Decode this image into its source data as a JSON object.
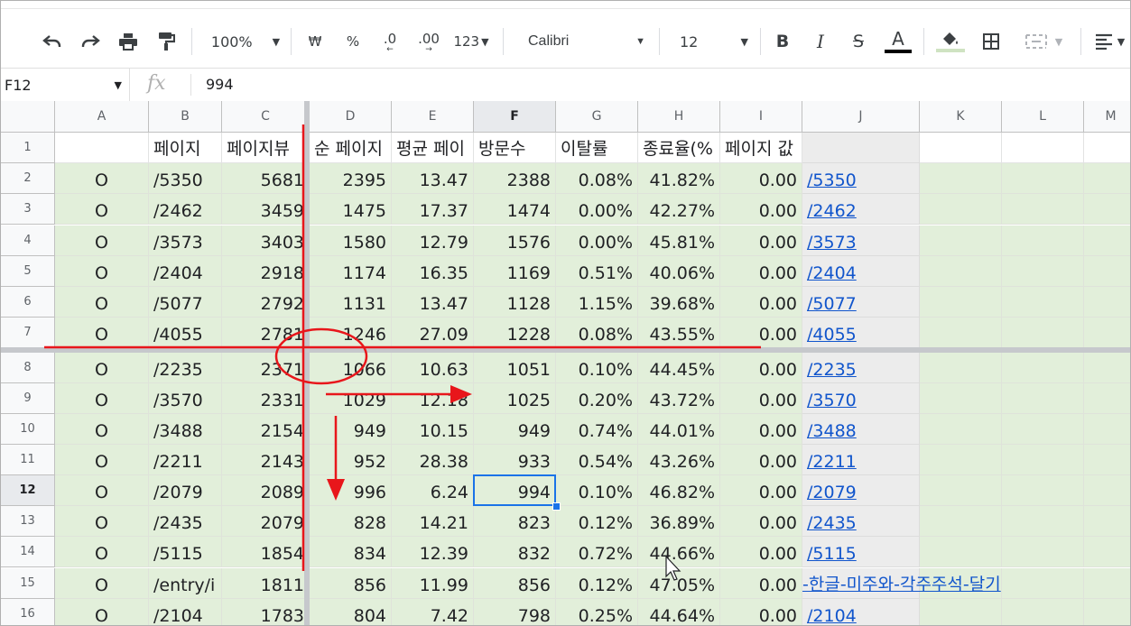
{
  "toolbar": {
    "zoom": "100%",
    "currency": "₩",
    "percent": "%",
    "dec_decrease": ".0",
    "dec_increase": ".00",
    "more_formats": "123",
    "font": "Calibri",
    "font_size": "12",
    "bold": "B",
    "italic": "I",
    "strike": "S",
    "text_color": "A",
    "text_color_value": "#000000",
    "fill_color_value": "#e2efda"
  },
  "formula_bar": {
    "name_box": "F12",
    "fx": "fx",
    "value": "994"
  },
  "columns": [
    "A",
    "B",
    "C",
    "D",
    "E",
    "F",
    "G",
    "H",
    "I",
    "J",
    "K",
    "L",
    "M"
  ],
  "selected_column": "F",
  "selected_row": "12",
  "header_row": [
    "",
    "페이지",
    "페이지뷰",
    "순 페이지",
    "평균 페이",
    "방문수",
    "이탈률",
    "종료율(%",
    "페이지 값",
    ""
  ],
  "rows": [
    {
      "n": "2",
      "a": "O",
      "b": "/5350",
      "c": "5681",
      "d": "2395",
      "e": "13.47",
      "f": "2388",
      "g": "0.08%",
      "h": "41.82%",
      "i": "0.00",
      "j": "/5350"
    },
    {
      "n": "3",
      "a": "O",
      "b": "/2462",
      "c": "3459",
      "d": "1475",
      "e": "17.37",
      "f": "1474",
      "g": "0.00%",
      "h": "42.27%",
      "i": "0.00",
      "j": "/2462"
    },
    {
      "n": "4",
      "a": "O",
      "b": "/3573",
      "c": "3403",
      "d": "1580",
      "e": "12.79",
      "f": "1576",
      "g": "0.00%",
      "h": "45.81%",
      "i": "0.00",
      "j": "/3573"
    },
    {
      "n": "5",
      "a": "O",
      "b": "/2404",
      "c": "2918",
      "d": "1174",
      "e": "16.35",
      "f": "1169",
      "g": "0.51%",
      "h": "40.06%",
      "i": "0.00",
      "j": "/2404"
    },
    {
      "n": "6",
      "a": "O",
      "b": "/5077",
      "c": "2792",
      "d": "1131",
      "e": "13.47",
      "f": "1128",
      "g": "1.15%",
      "h": "39.68%",
      "i": "0.00",
      "j": "/5077"
    },
    {
      "n": "7",
      "a": "O",
      "b": "/4055",
      "c": "2781",
      "d": "1246",
      "e": "27.09",
      "f": "1228",
      "g": "0.08%",
      "h": "43.55%",
      "i": "0.00",
      "j": "/4055"
    },
    {
      "n": "8",
      "a": "O",
      "b": "/2235",
      "c": "2371",
      "d": "1066",
      "e": "10.63",
      "f": "1051",
      "g": "0.10%",
      "h": "44.45%",
      "i": "0.00",
      "j": "/2235"
    },
    {
      "n": "9",
      "a": "O",
      "b": "/3570",
      "c": "2331",
      "d": "1029",
      "e": "12.18",
      "f": "1025",
      "g": "0.20%",
      "h": "43.72%",
      "i": "0.00",
      "j": "/3570"
    },
    {
      "n": "10",
      "a": "O",
      "b": "/3488",
      "c": "2154",
      "d": "949",
      "e": "10.15",
      "f": "949",
      "g": "0.74%",
      "h": "44.01%",
      "i": "0.00",
      "j": "/3488"
    },
    {
      "n": "11",
      "a": "O",
      "b": "/2211",
      "c": "2143",
      "d": "952",
      "e": "28.38",
      "f": "933",
      "g": "0.54%",
      "h": "43.26%",
      "i": "0.00",
      "j": "/2211"
    },
    {
      "n": "12",
      "a": "O",
      "b": "/2079",
      "c": "2089",
      "d": "996",
      "e": "6.24",
      "f": "994",
      "g": "0.10%",
      "h": "46.82%",
      "i": "0.00",
      "j": "/2079"
    },
    {
      "n": "13",
      "a": "O",
      "b": "/2435",
      "c": "2079",
      "d": "828",
      "e": "14.21",
      "f": "823",
      "g": "0.12%",
      "h": "36.89%",
      "i": "0.00",
      "j": "/2435"
    },
    {
      "n": "14",
      "a": "O",
      "b": "/5115",
      "c": "1854",
      "d": "834",
      "e": "12.39",
      "f": "832",
      "g": "0.72%",
      "h": "44.66%",
      "i": "0.00",
      "j": "/5115"
    },
    {
      "n": "15",
      "a": "O",
      "b": "/entry/i",
      "c": "1811",
      "d": "856",
      "e": "11.99",
      "f": "856",
      "g": "0.12%",
      "h": "47.05%",
      "i": "0.00",
      "j": "-한글-미주와-각주주석-달기"
    },
    {
      "n": "16",
      "a": "O",
      "b": "/2104",
      "c": "1783",
      "d": "804",
      "e": "7.42",
      "f": "798",
      "g": "0.25%",
      "h": "44.64%",
      "i": "0.00",
      "j": "/2104"
    }
  ],
  "colors": {
    "data_fill": "#e2efda",
    "link": "#1155cc",
    "selection": "#1a73e8",
    "annotation": "#e8161b"
  }
}
